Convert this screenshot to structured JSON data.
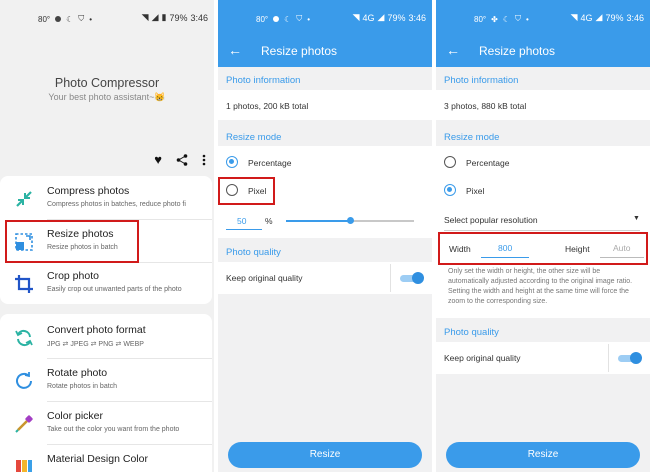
{
  "status": {
    "temp": "80°",
    "battery": "79%",
    "time": "3:46",
    "network": "4G"
  },
  "home": {
    "title": "Photo Compressor",
    "subtitle": "Your best photo assistant~😸",
    "items": [
      {
        "title": "Compress photos",
        "subtitle": "Compress photos in batches, reduce photo fi",
        "icon": "compress-icon"
      },
      {
        "title": "Resize photos",
        "subtitle": "Resize photos in batch",
        "icon": "resize-icon"
      },
      {
        "title": "Crop photo",
        "subtitle": "Easily crop out unwanted parts of the photo",
        "icon": "crop-icon"
      },
      {
        "title": "Convert photo format",
        "subtitle": "JPG ⇄ JPEG ⇄ PNG ⇄ WEBP",
        "icon": "convert-icon"
      },
      {
        "title": "Rotate photo",
        "subtitle": "Rotate photos in batch",
        "icon": "rotate-icon"
      },
      {
        "title": "Color picker",
        "subtitle": "Take out the color you want from the photo",
        "icon": "color-picker-icon"
      },
      {
        "title": "Material Design Color",
        "subtitle": "",
        "icon": "palette-icon"
      }
    ]
  },
  "resize": {
    "title": "Resize photos",
    "photo_info_label": "Photo information",
    "mode_label": "Resize mode",
    "percentage_label": "Percentage",
    "pixel_label": "Pixel",
    "quality_label": "Photo quality",
    "keep_quality_label": "Keep original quality",
    "button_label": "Resize",
    "screen_a": {
      "info": "1 photos, 200 kB total",
      "percent_value": "50",
      "percent_unit": "%",
      "slider_level": 0.5
    },
    "screen_b": {
      "info": "3 photos, 880 kB total",
      "resolution_label": "Select popular resolution",
      "width_label": "Width",
      "width_value": "800",
      "height_label": "Height",
      "height_placeholder": "Auto",
      "note": "Only set the width or height, the other size will be automatically adjusted according to the original image ratio. Setting the width and height at the same time will force the zoom to the corresponding size."
    }
  },
  "colors": {
    "accent": "#3a9bea",
    "highlight": "#d11a1a"
  }
}
